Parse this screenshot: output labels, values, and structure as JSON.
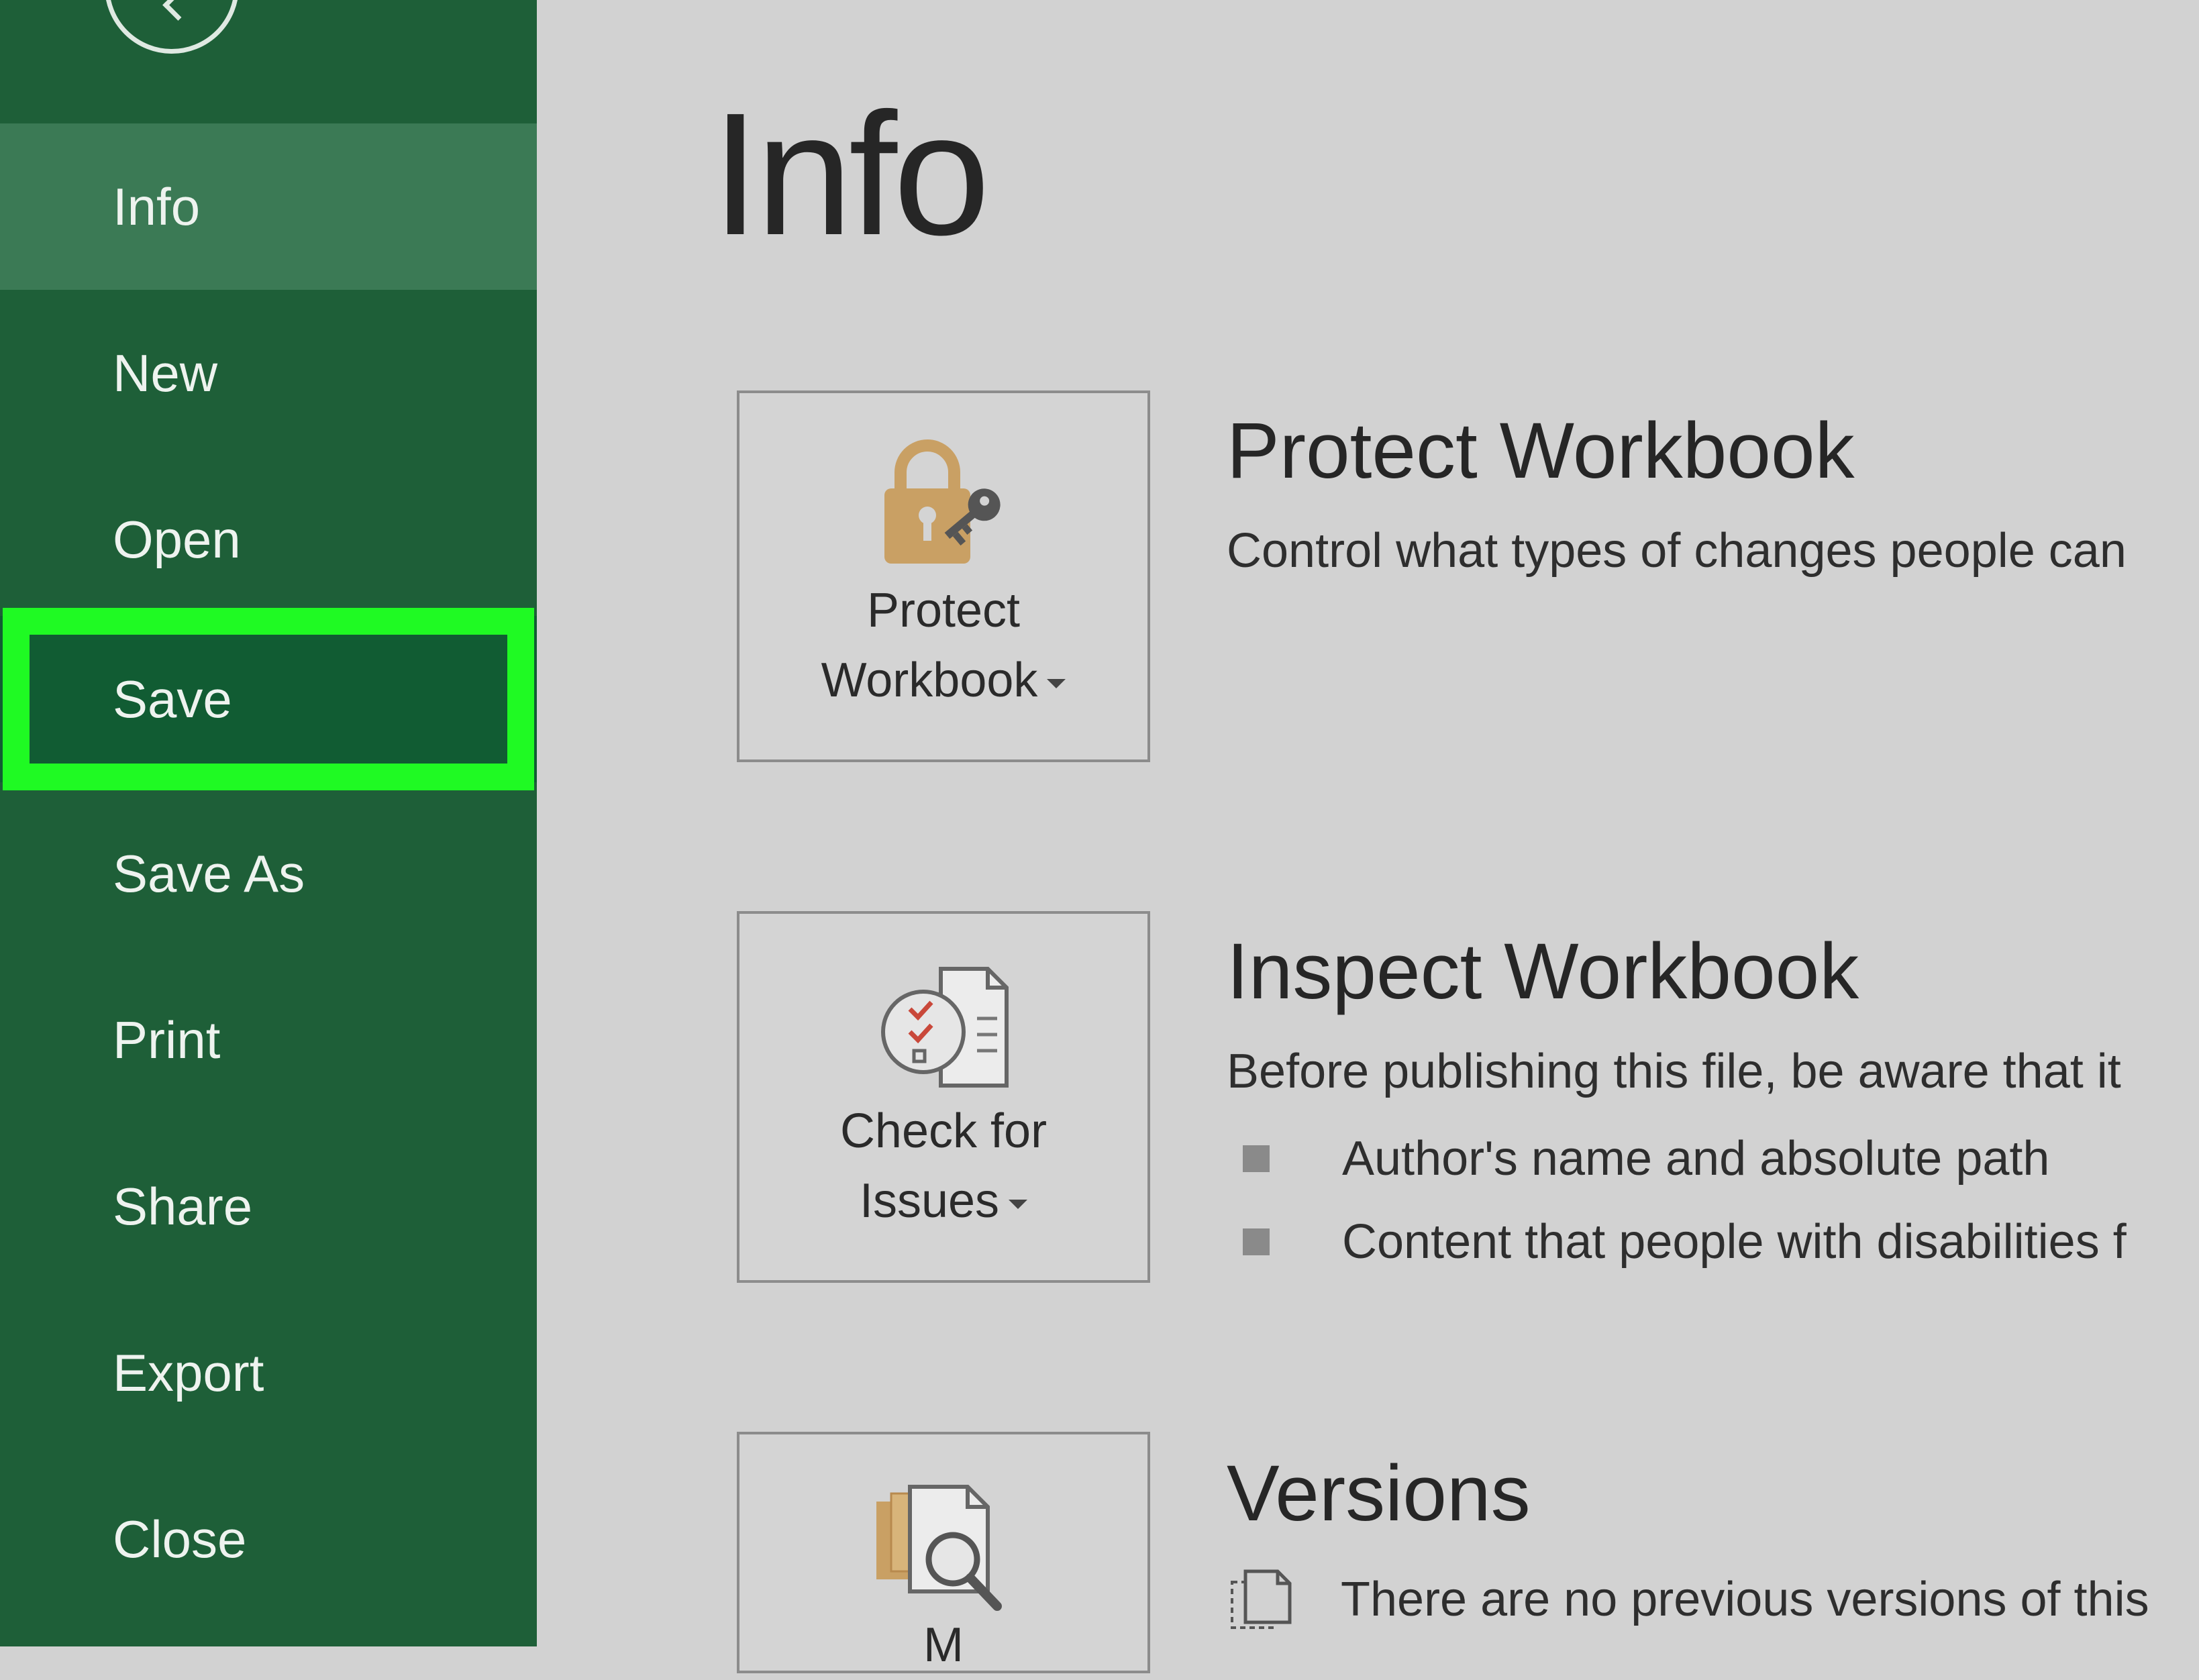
{
  "sidebar": {
    "items": [
      {
        "label": "Info"
      },
      {
        "label": "New"
      },
      {
        "label": "Open"
      },
      {
        "label": "Save"
      },
      {
        "label": "Save As"
      },
      {
        "label": "Print"
      },
      {
        "label": "Share"
      },
      {
        "label": "Export"
      },
      {
        "label": "Close"
      }
    ],
    "active_item": "Info",
    "highlighted_item": "Save"
  },
  "main": {
    "title": "Info",
    "sections": [
      {
        "button": {
          "line1": "Protect",
          "line2": "Workbook",
          "icon": "lock-key-icon"
        },
        "heading": "Protect Workbook",
        "description": "Control what types of changes people can"
      },
      {
        "button": {
          "line1": "Check for",
          "line2": "Issues",
          "icon": "document-inspect-icon"
        },
        "heading": "Inspect Workbook",
        "description": "Before publishing this file, be aware that it",
        "bullets": [
          "Author's name and absolute path",
          "Content that people with disabilities f"
        ]
      },
      {
        "button": {
          "line1": "M",
          "icon": "versions-search-icon"
        },
        "heading": "Versions",
        "note": "There are no previous versions of this"
      }
    ]
  },
  "colors": {
    "sidebar_bg": "#1e5f38",
    "active_item_bg": "#3b7a55",
    "highlight_frame": "#1ffa23",
    "main_bg": "#d2d2d2",
    "icon_gold": "#c9a064"
  }
}
